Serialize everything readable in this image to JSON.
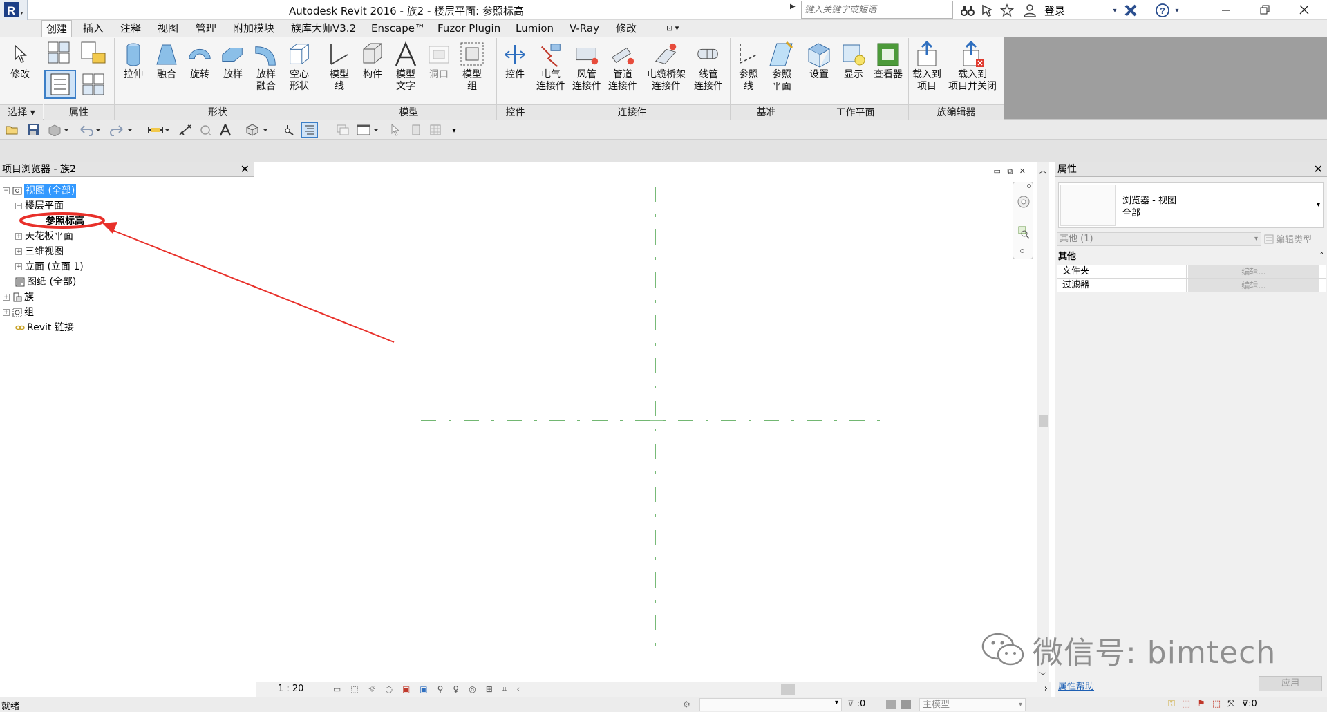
{
  "title_bar": {
    "window_title": "Autodesk Revit 2016 -    族2 - 楼层平面: 参照标高",
    "search_placeholder": "键入关键字或短语",
    "login_label": "登录"
  },
  "ribbon_tabs": [
    {
      "label": "创建",
      "active": true
    },
    {
      "label": "插入"
    },
    {
      "label": "注释"
    },
    {
      "label": "视图"
    },
    {
      "label": "管理"
    },
    {
      "label": "附加模块"
    },
    {
      "label": "族库大师V3.2"
    },
    {
      "label": "Enscape™"
    },
    {
      "label": "Fuzor Plugin"
    },
    {
      "label": "Lumion"
    },
    {
      "label": "V-Ray"
    },
    {
      "label": "修改"
    }
  ],
  "ribbon": {
    "buttons": {
      "modify": "修改",
      "extrusion": "拉伸",
      "blend": "融合",
      "revolve": "旋转",
      "sweep": "放样",
      "swept_blend": "放样\n融合",
      "void": "空心\n形状",
      "model_line": "模型\n线",
      "component": "构件",
      "model_text": "模型\n文字",
      "opening": "洞口",
      "model_group": "模型\n组",
      "control": "控件",
      "electrical": "电气\n连接件",
      "duct": "风管\n连接件",
      "pipe": "管道\n连接件",
      "cable_tray": "电缆桥架\n连接件",
      "conduit": "线管\n连接件",
      "ref_line": "参照\n线",
      "ref_plane": "参照\n平面",
      "set": "设置",
      "show": "显示",
      "viewer": "查看器",
      "load_into_project": "载入到\n项目",
      "load_and_close": "载入到\n项目并关闭"
    },
    "panels": {
      "select": "选择 ▾",
      "properties": "属性",
      "forms": "形状",
      "model": "模型",
      "control": "控件",
      "connectors": "连接件",
      "datum": "基准",
      "work_plane": "工作平面",
      "family_editor": "族编辑器"
    }
  },
  "project_browser": {
    "title": "项目浏览器 - 族2",
    "items": {
      "views": "视图 (全部)",
      "floor_plans": "楼层平面",
      "ref_level": "参照标高",
      "ceiling_plans": "天花板平面",
      "three_d": "三维视图",
      "elevations": "立面 (立面 1)",
      "sheets": "图纸 (全部)",
      "families": "族",
      "groups": "组",
      "revit_links": "Revit 链接"
    }
  },
  "view_control_bar": {
    "scale": "1 : 20"
  },
  "properties": {
    "title": "属性",
    "type_name": "浏览器 - 视图",
    "type_sub": "全部",
    "instance_filter": "其他 (1)",
    "edit_type": "编辑类型",
    "group_other": "其他",
    "rows": [
      {
        "name": "文件夹",
        "value": "编辑..."
      },
      {
        "name": "过滤器",
        "value": "编辑..."
      }
    ],
    "help_link": "属性帮助",
    "apply": "应用"
  },
  "status_bar": {
    "status": "就绪",
    "count1": ":0",
    "model": "主模型",
    "count2": ":0"
  },
  "watermark": "微信号: bimtech",
  "colors": {
    "reference_plane": "#1e8c1e",
    "annotation": "#e8302a",
    "selection": "#3399ff"
  }
}
